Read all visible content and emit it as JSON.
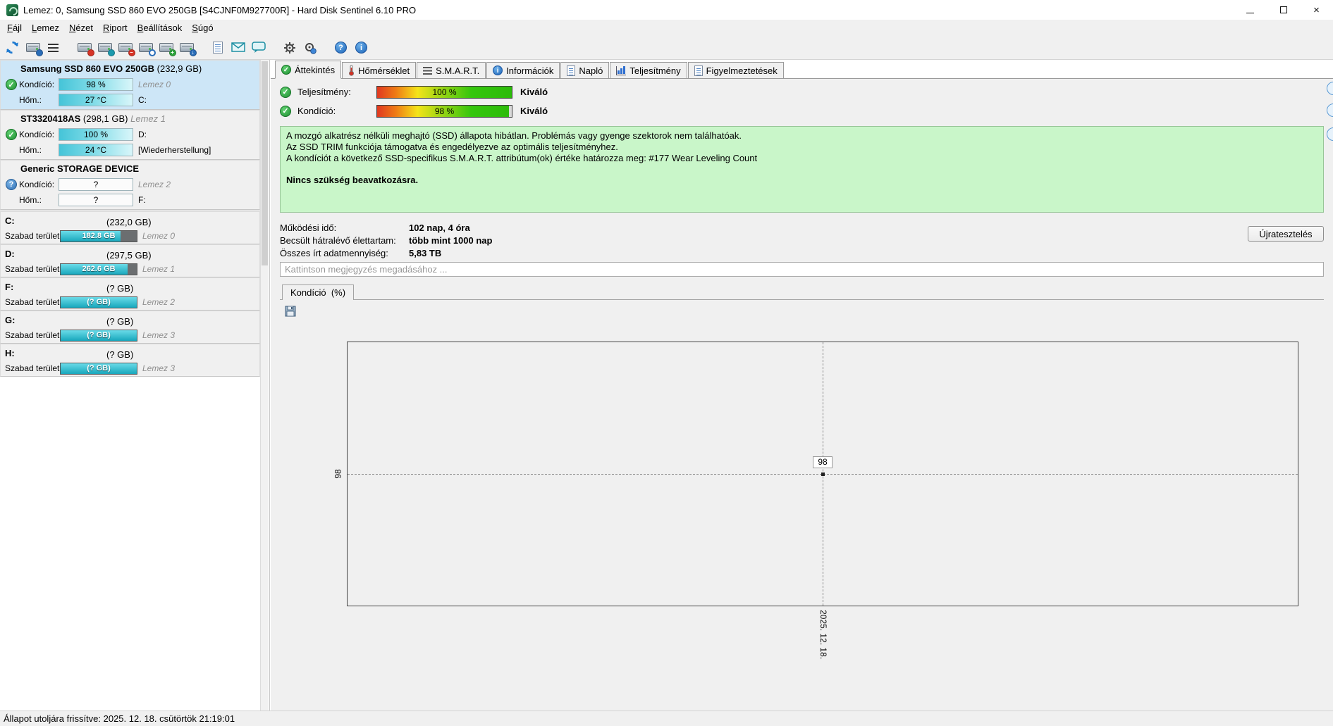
{
  "window": {
    "title": "Lemez: 0, Samsung SSD 860 EVO 250GB [S4CJNF0M927700R]  -  Hard Disk Sentinel 6.10 PRO",
    "controls": [
      "minimize",
      "maximize",
      "close"
    ]
  },
  "menubar": {
    "items": [
      "Fájl",
      "Lemez",
      "Nézet",
      "Riport",
      "Beállítások",
      "Súgó"
    ]
  },
  "toolbar": {
    "icons": [
      "refresh-icon",
      "disk-rescan-icon",
      "list-icon",
      "disk-error-icon",
      "disk-tools-icon",
      "disk-remove-icon",
      "disk-search-icon",
      "disk-status-icon",
      "disk-export-icon",
      "report-icon",
      "mail-icon",
      "chat-icon",
      "settings-gear-icon",
      "advanced-settings-icon",
      "help-icon",
      "info-icon"
    ]
  },
  "sidebar": {
    "labels": {
      "free": "Szabad terület"
    },
    "disks": [
      {
        "name": "Samsung SSD 860 EVO 250GB",
        "size": "(232,9 GB)",
        "suffix": "",
        "row1": {
          "label": "Kondíció:",
          "value": "98 %",
          "right": "Lemez 0"
        },
        "row2": {
          "label": "Hőm.:",
          "value": "27 °C",
          "right": "C:"
        }
      },
      {
        "name": "ST3320418AS",
        "size": "(298,1 GB)",
        "suffix": "Lemez 1",
        "row1": {
          "label": "Kondíció:",
          "value": "100 %",
          "right": "D:"
        },
        "row2": {
          "label": "Hőm.:",
          "value": "24 °C",
          "right": "[Wiederherstellung]"
        }
      },
      {
        "name": "Generic STORAGE DEVICE",
        "size": "",
        "suffix": "",
        "row1": {
          "label": "Kondíció:",
          "value": "?",
          "right": "Lemez 2"
        },
        "row2": {
          "label": "Hőm.:",
          "value": "?",
          "right": "F:"
        }
      }
    ],
    "partitions": [
      {
        "drive": "C:",
        "size": "(232,0 GB)",
        "free_text": "182.8 GB",
        "free_pct": 79,
        "lemez": "Lemez 0"
      },
      {
        "drive": "D:",
        "size": "(297,5 GB)",
        "free_text": "262.6 GB",
        "free_pct": 88,
        "lemez": "Lemez 1"
      },
      {
        "drive": "F:",
        "size": "(? GB)",
        "free_text": "(? GB)",
        "free_pct": 100,
        "lemez": "Lemez 2"
      },
      {
        "drive": "G:",
        "size": "(? GB)",
        "free_text": "(? GB)",
        "free_pct": 100,
        "lemez": "Lemez 3"
      },
      {
        "drive": "H:",
        "size": "(? GB)",
        "free_text": "(? GB)",
        "free_pct": 100,
        "lemez": "Lemez 3"
      }
    ]
  },
  "main": {
    "tabs": [
      {
        "label": "Áttekintés",
        "icon": "check-circle-icon",
        "selected": true
      },
      {
        "label": "Hőmérséklet",
        "icon": "thermometer-icon",
        "selected": false
      },
      {
        "label": "S.M.A.R.T.",
        "icon": "attributes-icon",
        "selected": false
      },
      {
        "label": "Információk",
        "icon": "info-circle-icon",
        "selected": false
      },
      {
        "label": "Napló",
        "icon": "document-icon",
        "selected": false
      },
      {
        "label": "Teljesítmény",
        "icon": "chart-icon",
        "selected": false
      },
      {
        "label": "Figyelmeztetések",
        "icon": "page-icon",
        "selected": false
      }
    ],
    "gauges": [
      {
        "label": "Teljesítmény:",
        "value": "100 %",
        "pct": 100,
        "remain_pct": 0,
        "rating": "Kiváló"
      },
      {
        "label": "Kondíció:",
        "value": "98 %",
        "pct": 98,
        "remain_pct": 2,
        "rating": "Kiváló"
      }
    ],
    "health": {
      "lines": [
        "A mozgó alkatrész nélküli meghajtó (SSD) állapota hibátlan. Problémás vagy gyenge szektorok nem találhatóak.",
        "Az SSD TRIM funkciója támogatva és engedélyezve az optimális teljesítményhez.",
        "A kondíciót a következő SSD-specifikus S.M.A.R.T. attribútum(ok) értéke határozza meg:  #177 Wear Leveling Count"
      ],
      "action": "Nincs szükség beavatkozásra."
    },
    "stats": [
      {
        "label": "Működési idő:",
        "value": "102 nap, 4 óra"
      },
      {
        "label": "Becsült hátralévő élettartam:",
        "value": "több mint 1000 nap"
      },
      {
        "label": "Összes írt adatmennyiség:",
        "value": "5,83 TB"
      }
    ],
    "retest_label": "Újratesztelés",
    "comment_placeholder": "Kattintson megjegyzés megadásához ...",
    "subtab_label": "Kondíció  (%)"
  },
  "chart_data": {
    "type": "line",
    "title": "Kondíció (%)",
    "x": [
      "2025. 12. 18."
    ],
    "series": [
      {
        "name": "Kondíció",
        "values": [
          98
        ]
      }
    ],
    "ylim": null,
    "ytick": "98",
    "point_label": "98",
    "grid": "dashed-crosshair",
    "legend": "none"
  },
  "statusbar": {
    "text": "Állapot utoljára frissítve: 2025. 12. 18. csütörtök 21:19:01"
  }
}
